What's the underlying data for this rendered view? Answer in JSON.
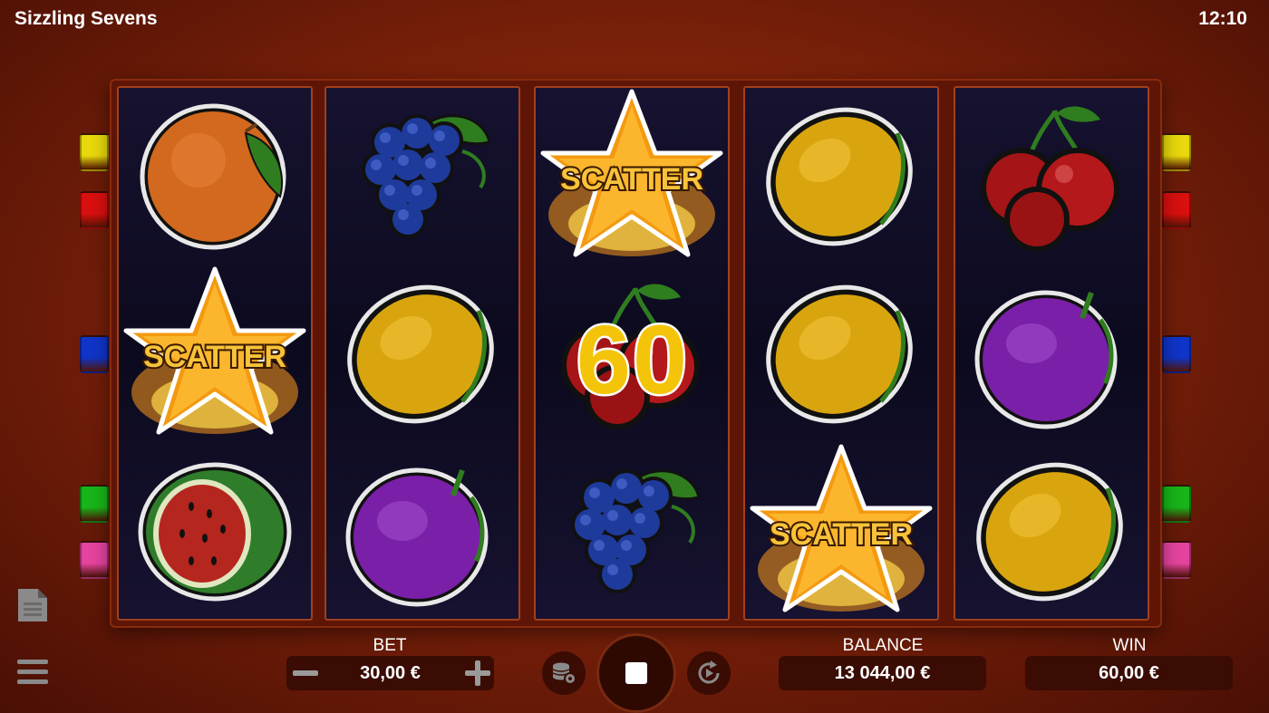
{
  "header": {
    "title": "Sizzling Sevens",
    "clock": "12:10"
  },
  "reels": [
    [
      "orange",
      "scatter",
      "watermelon"
    ],
    [
      "grapes",
      "lemon",
      "plum"
    ],
    [
      "scatter",
      "cherries",
      "grapes"
    ],
    [
      "lemon",
      "lemon",
      "scatter"
    ],
    [
      "cherries",
      "plum",
      "lemon"
    ]
  ],
  "symbols": {
    "scatter_label": "SCATTER"
  },
  "win_overlay": {
    "value": "60"
  },
  "paylines": {
    "left": [
      "#e8d80c",
      "#d8100f",
      "#1034c8",
      "#18b51a",
      "#e4449e"
    ],
    "right": [
      "#e8d80c",
      "#d8100f",
      "#1034c8",
      "#18b51a",
      "#e4449e"
    ]
  },
  "controls": {
    "bet_label": "BET",
    "bet_value": "30,00 €",
    "balance_label": "BALANCE",
    "balance_value": "13 044,00 €",
    "win_label": "WIN",
    "win_value": "60,00 €",
    "minus_icon": "minus-icon",
    "plus_icon": "plus-icon",
    "stop_icon": "stop-icon",
    "autoplay_icon": "autoplay-icon",
    "settings_icon": "coins-settings-icon",
    "paytable_icon": "document-icon",
    "menu_icon": "hamburger-menu-icon"
  }
}
